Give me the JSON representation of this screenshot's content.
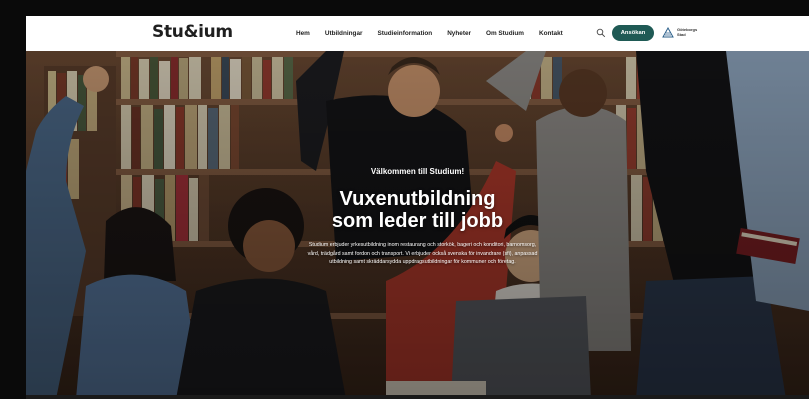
{
  "brand": {
    "logo": "Stu&ium"
  },
  "nav": {
    "items": [
      {
        "label": "Hem"
      },
      {
        "label": "Utbildningar"
      },
      {
        "label": "Studieinformation"
      },
      {
        "label": "Nyheter"
      },
      {
        "label": "Om Studium"
      },
      {
        "label": "Kontakt"
      }
    ],
    "search_icon": "search-icon",
    "apply_label": "Ansökan",
    "partner_logo_text": "Göteborgs Stad"
  },
  "hero": {
    "welcome": "Välkommen till Studium!",
    "headline_line1": "Vuxenutbildning",
    "headline_line2": "som leder till jobb",
    "lead": "Studium erbjuder yrkesutbildning inom restaurang och storkök, bageri och konditori, barnomsorg, vård, trädgård samt fordon och transport. Vi erbjuder också svenska för invandrare (sfi), anpassad utbildning samt skräddarsydda uppdragsutbildningar för kommuner och företag."
  },
  "colors": {
    "accent": "#1f5a55",
    "header_bg": "#ffffff",
    "text_dark": "#222222"
  }
}
